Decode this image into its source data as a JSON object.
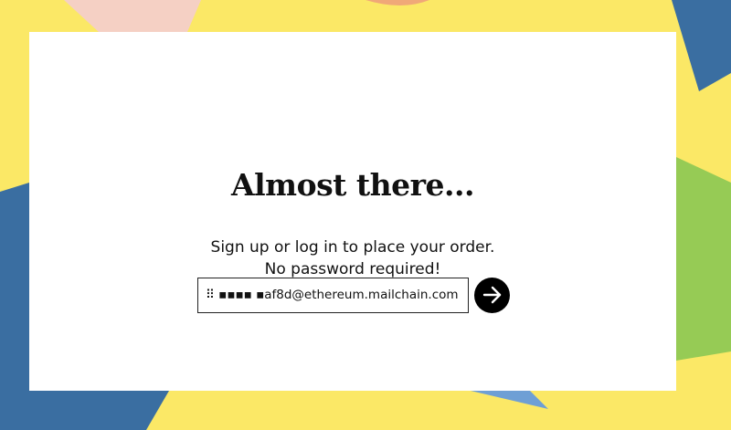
{
  "page": {
    "background_color": "#fbe866",
    "shape_colors": {
      "pink": "#f5d0c4",
      "blue": "#3a6ea1",
      "light_blue": "#6e9fd5",
      "green": "#96cb55",
      "orange": "#f0a878"
    }
  },
  "card": {
    "title": "Almost there...",
    "subtitle_line1": "Sign up or log in to place your order.",
    "subtitle_line2": "No password required!"
  },
  "login": {
    "email_value": "⠿ ▪▪▪▪ ▪af8d@ethereum.mailchain.com",
    "submit_icon": "arrow-right-icon"
  }
}
